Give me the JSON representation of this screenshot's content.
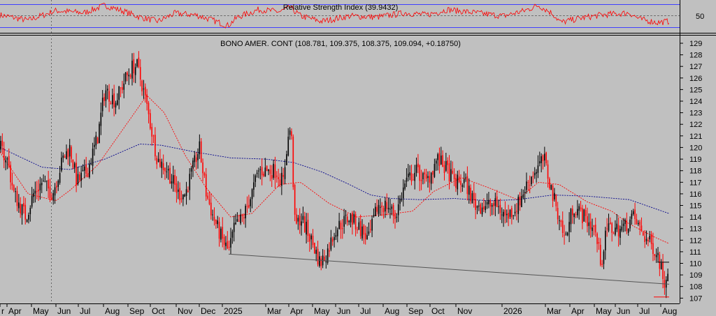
{
  "chart_data": [
    {
      "type": "line",
      "title": "Relative Strength Index (39.9432)",
      "ylim": [
        20,
        80
      ],
      "y_ticks": [
        50
      ],
      "reference_levels": [
        30,
        50,
        70
      ],
      "series": [
        {
          "color": "#ff0000",
          "x": [
            0,
            40,
            80,
            120,
            150,
            170,
            200,
            226,
            250,
            280,
            300,
            326,
            340,
            370,
            400,
            415,
            430,
            460,
            500,
            540,
            580,
            610,
            640,
            680,
            720,
            750,
            770,
            790,
            802,
            830,
            860,
            900,
            915,
            940,
            957
          ],
          "values": [
            52,
            42,
            60,
            56,
            70,
            62,
            48,
            40,
            55,
            52,
            44,
            32,
            48,
            62,
            58,
            66,
            50,
            40,
            50,
            48,
            56,
            52,
            62,
            56,
            50,
            60,
            70,
            55,
            38,
            46,
            52,
            56,
            44,
            38,
            40
          ]
        }
      ]
    },
    {
      "type": "candlestick",
      "title": "BONO AMER. CONT (108.781, 109.375, 108.375, 109.094, +0.18750)",
      "ylim": [
        106.6,
        129.6
      ],
      "y_ticks": [
        107,
        108,
        109,
        110,
        111,
        112,
        113,
        114,
        115,
        116,
        117,
        118,
        119,
        120,
        121,
        122,
        123,
        124,
        125,
        126,
        127,
        128,
        129
      ],
      "x_ticks": [
        "r",
        "Apr",
        "May",
        "Jun",
        "Jul",
        "Aug",
        "Sep",
        "Oct",
        "Nov",
        "Dec",
        "2025",
        "Mar",
        "Apr",
        "May",
        "Jun",
        "Jul",
        "Aug",
        "Sep",
        "Oct",
        "Nov",
        "2026",
        "Mar",
        "Apr",
        "May",
        "Jun",
        "Jul",
        "Aug"
      ],
      "price_keypoints": {
        "x": [
          0,
          10,
          20,
          37,
          48,
          60,
          75,
          90,
          100,
          110,
          125,
          140,
          150,
          165,
          180,
          190,
          196,
          205,
          215,
          225,
          240,
          255,
          265,
          275,
          285,
          295,
          305,
          318,
          327,
          335,
          348,
          360,
          370,
          380,
          395,
          405,
          410,
          416,
          422,
          430,
          445,
          458,
          468,
          480,
          500,
          515,
          527,
          540,
          555,
          565,
          580,
          595,
          610,
          625,
          640,
          650,
          665,
          680,
          695,
          710,
          725,
          740,
          755,
          765,
          778,
          790,
          800,
          808,
          820,
          835,
          850,
          860,
          868,
          880,
          890,
          905,
          915,
          925,
          940,
          950,
          957
        ],
        "values": [
          120,
          119,
          116,
          114,
          116,
          117,
          116,
          119,
          120,
          117,
          118,
          121,
          125,
          124,
          126,
          127,
          127,
          125,
          122,
          119,
          118,
          116,
          116,
          118,
          120,
          116,
          114,
          112,
          111,
          113,
          114,
          116,
          118,
          118,
          118,
          117,
          120,
          122,
          113,
          114,
          112,
          110,
          111,
          113,
          114,
          113,
          112,
          115,
          115,
          114,
          117,
          118,
          117,
          119,
          118,
          117,
          117,
          115,
          115,
          115,
          114,
          115,
          117,
          118,
          119,
          116,
          114,
          112,
          115,
          114,
          113,
          110,
          113,
          113,
          113,
          114,
          113,
          112,
          111,
          108.5,
          109.1
        ]
      },
      "moving_averages": [
        {
          "color": "#ff0000",
          "x": [
            0,
            40,
            80,
            100,
            140,
            175,
            210,
            235,
            265,
            295,
            330,
            360,
            400,
            430,
            470,
            510,
            550,
            590,
            620,
            660,
            700,
            740,
            770,
            800,
            840,
            875,
            900,
            935,
            957
          ],
          "values": [
            119.6,
            116,
            115.4,
            116.3,
            118.5,
            121.5,
            124.5,
            123,
            119.3,
            116.5,
            114,
            114.3,
            116.8,
            117,
            115.2,
            114,
            114.2,
            114.5,
            116.2,
            117.4,
            116.5,
            115.5,
            117,
            116.8,
            115.3,
            114.5,
            113.4,
            112.3,
            111.7
          ]
        },
        {
          "color": "#00008b",
          "x": [
            0,
            60,
            100,
            150,
            200,
            230,
            280,
            330,
            380,
            420,
            460,
            500,
            530,
            560,
            600,
            650,
            700,
            740,
            790,
            840,
            900,
            957
          ],
          "values": [
            120,
            118.3,
            118.1,
            119,
            120.3,
            120.2,
            119.6,
            119.1,
            119,
            118.7,
            117.9,
            116.8,
            115.9,
            115.6,
            115.5,
            115.6,
            115.4,
            115.5,
            115.9,
            115.8,
            115.5,
            114.3
          ]
        }
      ],
      "trendlines": [
        {
          "color": "#555555",
          "x": [
            327,
            957
          ],
          "values": [
            110.8,
            108.2
          ]
        },
        {
          "color": "#000000",
          "x": [
            940,
            957
          ],
          "values": [
            110.1,
            110.1
          ]
        },
        {
          "color": "#ff0000",
          "x": [
            935,
            957
          ],
          "values": [
            107.1,
            107.1
          ]
        }
      ]
    }
  ]
}
